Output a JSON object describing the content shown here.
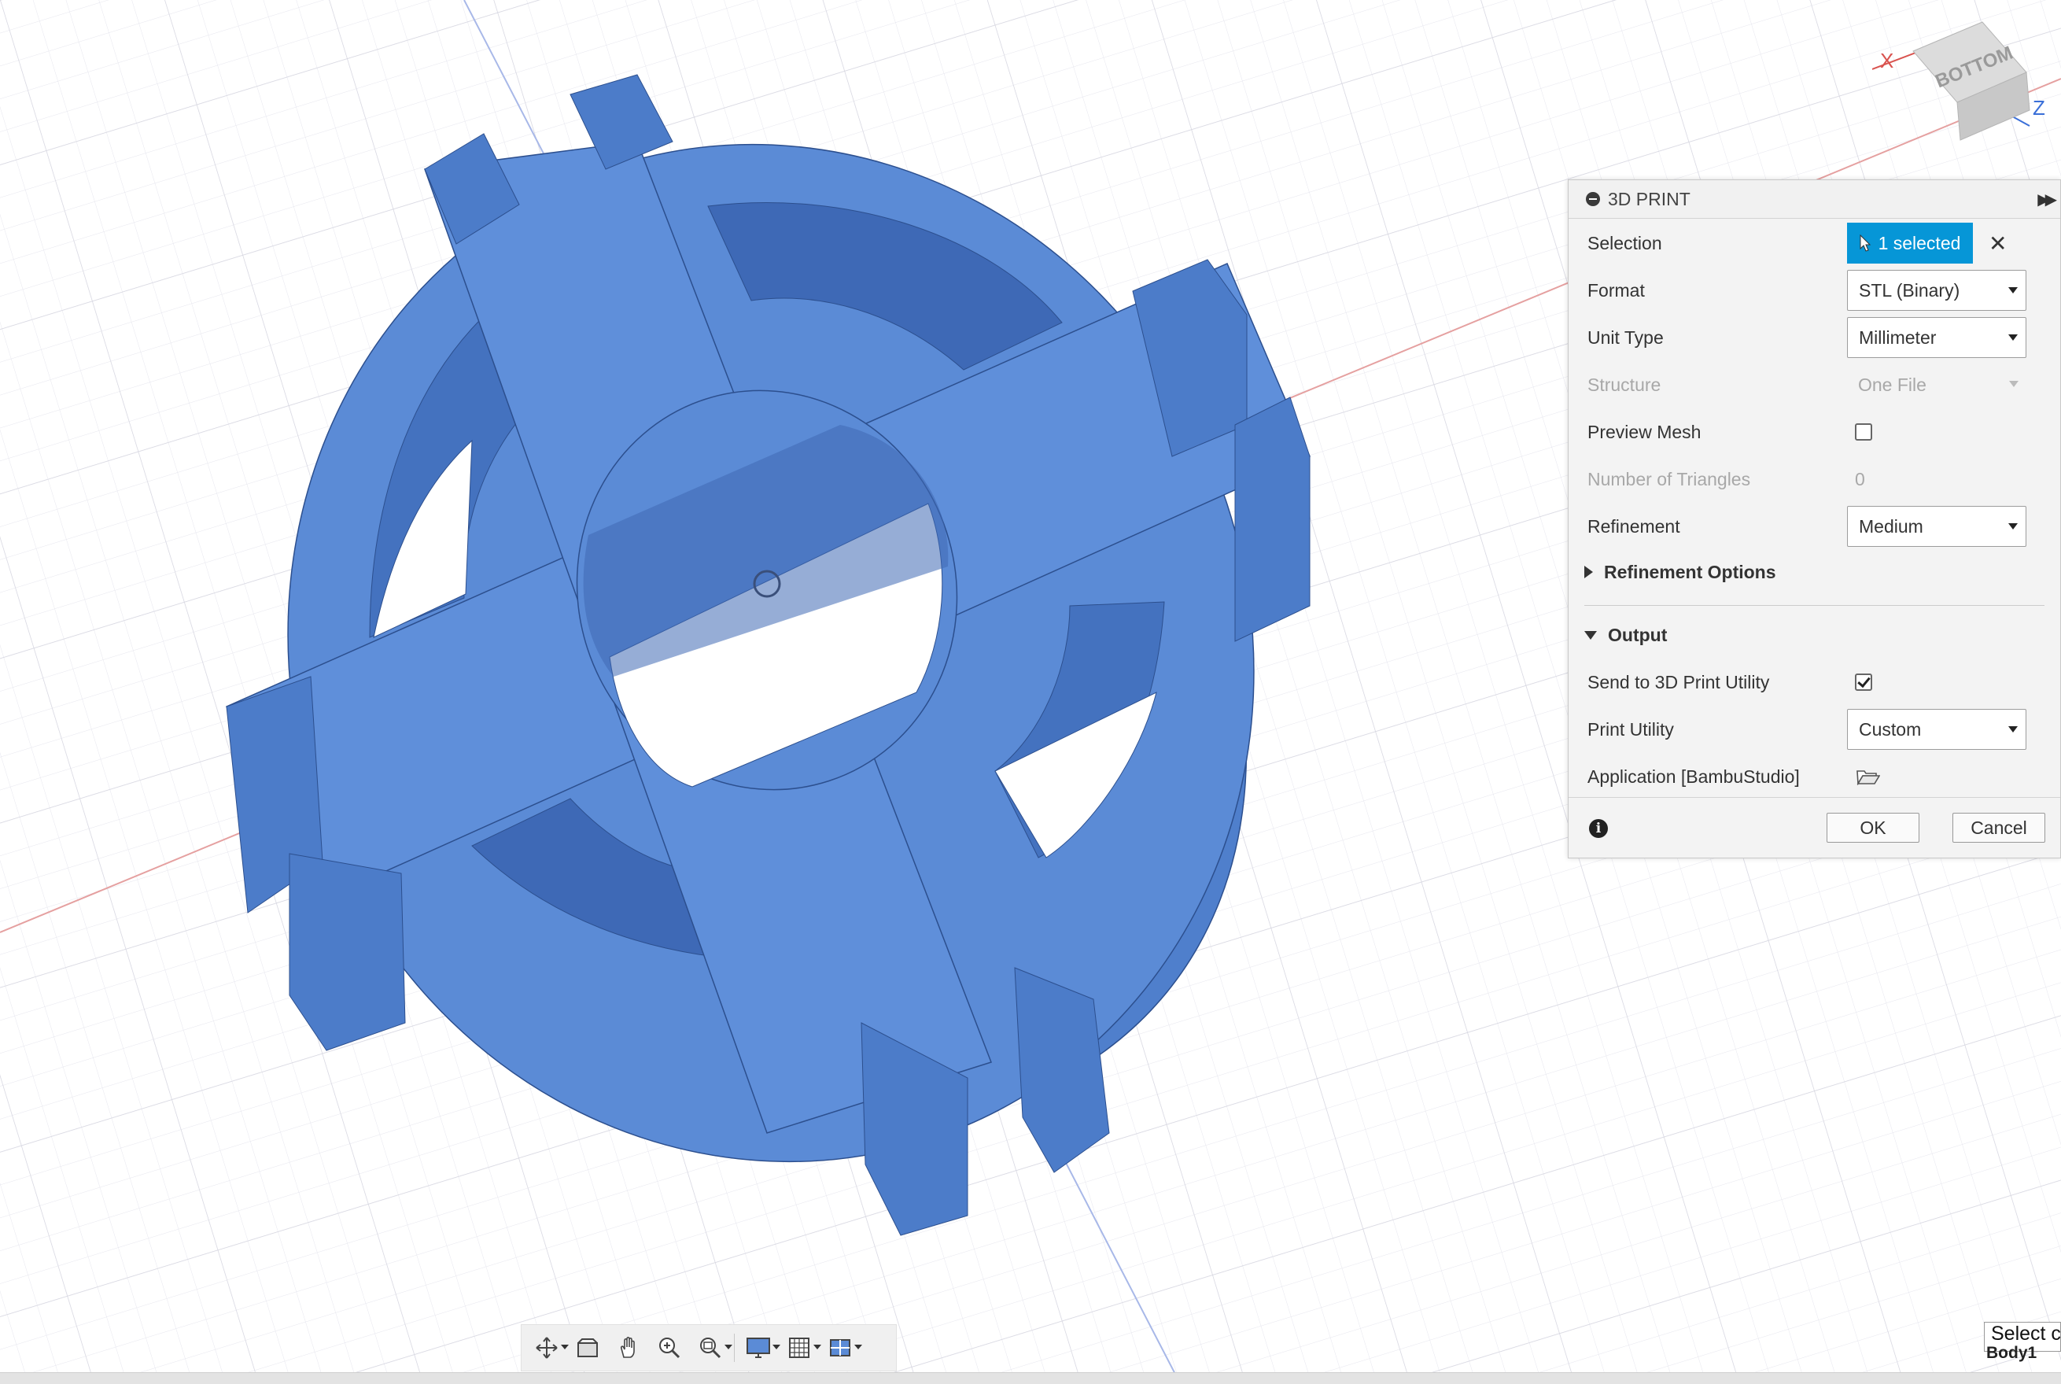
{
  "viewcube": {
    "face_label": "BOTTOM",
    "axis_x": "X",
    "axis_z": "Z"
  },
  "dialog": {
    "title": "3D PRINT",
    "selection": {
      "label": "Selection",
      "value": "1 selected"
    },
    "format": {
      "label": "Format",
      "value": "STL (Binary)"
    },
    "unit_type": {
      "label": "Unit Type",
      "value": "Millimeter"
    },
    "structure": {
      "label": "Structure",
      "value": "One File"
    },
    "preview_mesh": {
      "label": "Preview Mesh",
      "checked": false
    },
    "triangles": {
      "label": "Number of Triangles",
      "value": "0"
    },
    "refinement": {
      "label": "Refinement",
      "value": "Medium"
    },
    "refinement_options": {
      "label": "Refinement Options"
    },
    "output": {
      "label": "Output"
    },
    "send_to_utility": {
      "label": "Send to 3D Print Utility",
      "checked": true
    },
    "print_utility": {
      "label": "Print Utility",
      "value": "Custom"
    },
    "application": {
      "label": "Application [BambuStudio]"
    },
    "ok_label": "OK",
    "cancel_label": "Cancel"
  },
  "status": {
    "tooltip": "Select c",
    "body_label": "Body1"
  },
  "colors": {
    "accent": "#0696d7",
    "model_blue": "#5b8bd6"
  }
}
